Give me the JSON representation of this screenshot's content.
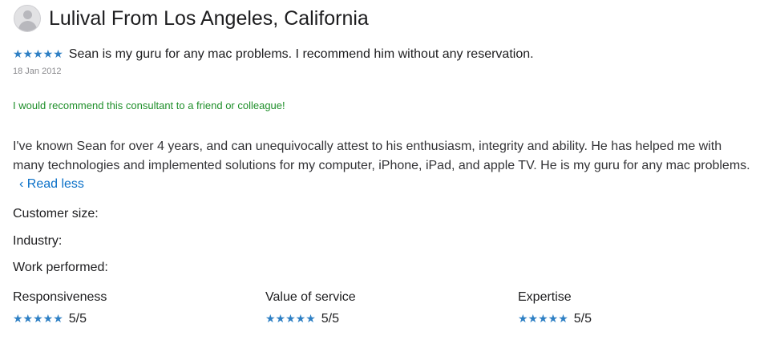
{
  "reviewer": {
    "name": "Lulival From Los Angeles, California",
    "avatar_icon": "user-avatar-icon"
  },
  "review": {
    "stars": "★★★★★",
    "rating_fraction": 1.0,
    "title": "Sean is my guru for any mac problems. I recommend him without any reservation.",
    "date": "18 Jan 2012",
    "recommendation": "I would recommend this consultant to a friend or colleague!",
    "body": "I've known Sean for over 4 years, and can unequivocally attest to his enthusiasm, integrity and ability. He has helped me with many technologies and implemented solutions for my computer, iPhone, iPad, and apple TV. He is my guru for any mac problems.",
    "read_less": "‹ Read less"
  },
  "details": {
    "customer_size": "Customer size:",
    "industry": "Industry:",
    "work_performed": "Work performed:"
  },
  "ratings": [
    {
      "label": "Responsiveness",
      "stars": "★★★★★",
      "score": "5/5"
    },
    {
      "label": "Value of service",
      "stars": "★★★★★",
      "score": "5/5"
    },
    {
      "label": "Expertise",
      "stars": "★★★★★",
      "score": "5/5"
    }
  ],
  "colors": {
    "star": "#2d7fc4",
    "recommend": "#1f8f2a",
    "link": "#0a70c8",
    "date": "#8a8a8e"
  }
}
